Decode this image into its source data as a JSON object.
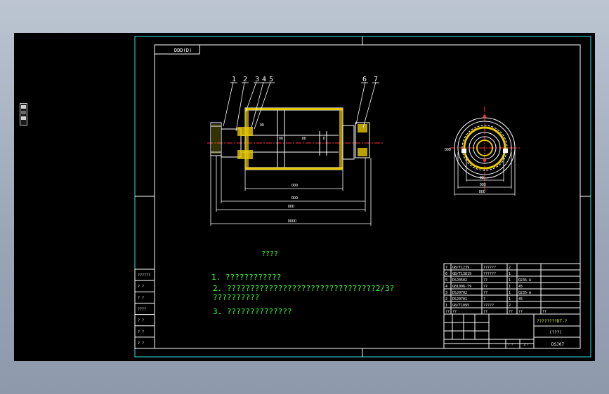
{
  "drawing": {
    "title_tab": "DDD(D)",
    "part_numbers": [
      "1",
      "2",
      "3",
      "4",
      "5",
      "6",
      "7"
    ],
    "dimensions": {
      "dim_a": "DD",
      "dim_b": "DDD",
      "dim_c": "DDD",
      "dim_d": "DDDD",
      "dim_v1": "DD",
      "dim_v2": "DD",
      "dim_v3": "DD",
      "dim_v4": "D",
      "dim_r1": "DD",
      "dim_r2": "DDD",
      "dim_r3": "DDD",
      "dim_r4": "DDD"
    },
    "notes_title": "????",
    "notes": [
      "1. ????????????",
      "2. ????????????????????????????????2/3?",
      "   ??????????",
      "3. ??????????????"
    ],
    "left_strip": [
      "??????",
      "? ?",
      "? ?",
      "????",
      "? ?",
      "? ?",
      "? ?"
    ],
    "bom": [
      {
        "no": "7",
        "code": "GB/T1239",
        "name": "??????",
        "qty": "2",
        "mat": "",
        "note": ""
      },
      {
        "no": "6",
        "code": "GB/T13819",
        "name": "??????",
        "qty": "1",
        "mat": "",
        "note": ""
      },
      {
        "no": "5",
        "code": "DSJ0502",
        "name": "??",
        "qty": "1",
        "mat": "Q235-A",
        "note": ""
      },
      {
        "no": "4",
        "code": "GB1096-79",
        "name": "??",
        "qty": "1",
        "mat": "45",
        "note": ""
      },
      {
        "no": "3",
        "code": "DSJ0702",
        "name": "??",
        "qty": "1",
        "mat": "Q235-A",
        "note": ""
      },
      {
        "no": "2",
        "code": "DSJ0701",
        "name": "?",
        "qty": "1",
        "mat": "45",
        "note": ""
      },
      {
        "no": "1",
        "code": "GB/T1095",
        "name": "?????",
        "qty": "2",
        "mat": "",
        "note": ""
      }
    ],
    "bom_header": {
      "no": "??",
      "code": "??",
      "name": "??",
      "qty": "??",
      "mat": "??",
      "note": "??"
    },
    "title_block": {
      "title": "????????DT-?",
      "subtitle": "(???)",
      "drawing_no": "DSJ07",
      "scale": "1:?",
      "sheet": "? ?"
    }
  }
}
